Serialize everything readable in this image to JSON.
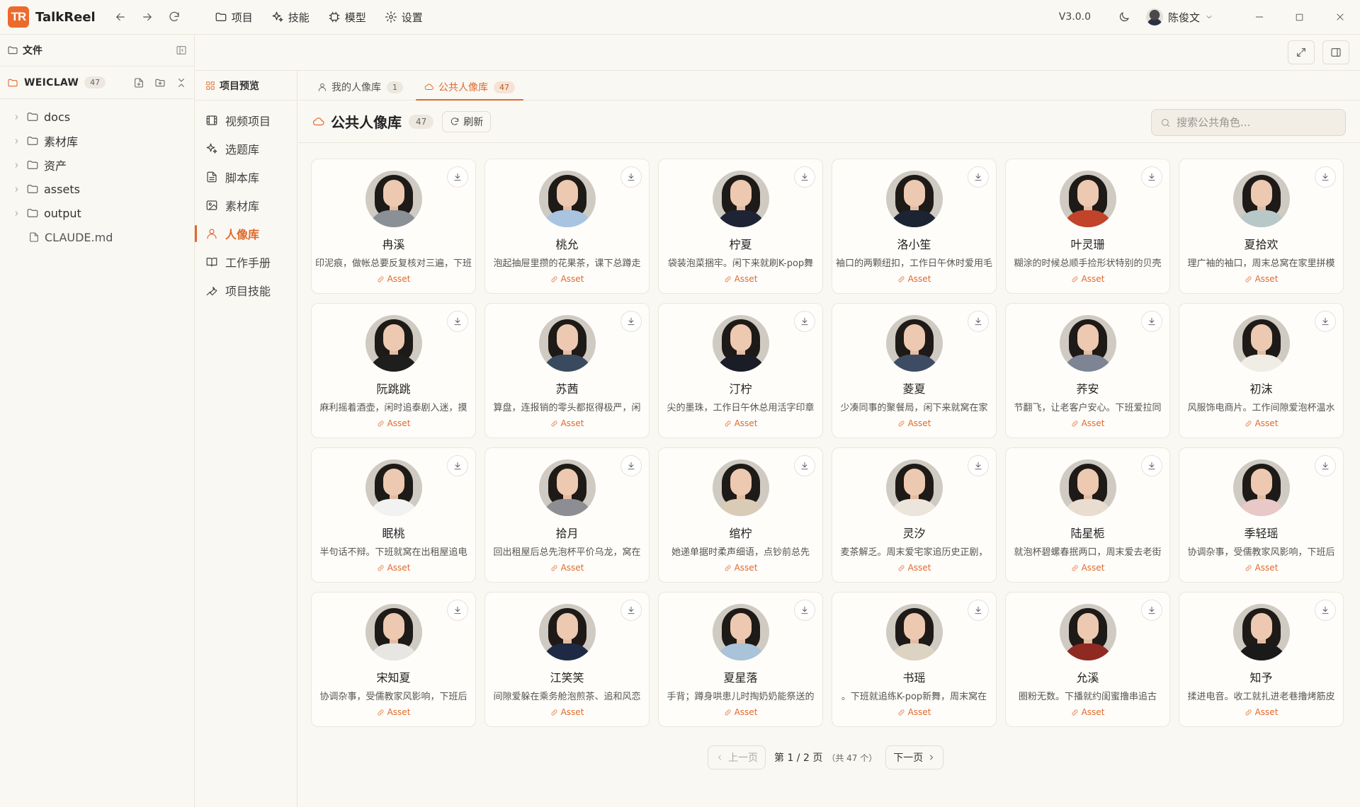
{
  "app": {
    "name": "TalkReel",
    "logo_text": "TR",
    "version": "V3.0.0",
    "user": "陈俊文",
    "accent": "#e0692c"
  },
  "menu": [
    "项目",
    "技能",
    "模型",
    "设置"
  ],
  "file_panel": {
    "title": "文件",
    "workspace": "WEICLAW",
    "workspace_count": "47",
    "tree": [
      {
        "name": "docs",
        "type": "folder"
      },
      {
        "name": "素材库",
        "type": "folder"
      },
      {
        "name": "资产",
        "type": "folder"
      },
      {
        "name": "assets",
        "type": "folder"
      },
      {
        "name": "output",
        "type": "folder"
      },
      {
        "name": "CLAUDE.md",
        "type": "file"
      }
    ]
  },
  "project_nav": {
    "title": "项目预览",
    "items": [
      {
        "label": "视频项目",
        "icon": "film-icon",
        "active": false
      },
      {
        "label": "选题库",
        "icon": "sparkle-icon",
        "active": false
      },
      {
        "label": "脚本库",
        "icon": "document-icon",
        "active": false
      },
      {
        "label": "素材库",
        "icon": "image-icon",
        "active": false
      },
      {
        "label": "人像库",
        "icon": "user-icon",
        "active": true
      },
      {
        "label": "工作手册",
        "icon": "book-icon",
        "active": false
      },
      {
        "label": "项目技能",
        "icon": "wrench-icon",
        "active": false
      }
    ]
  },
  "tabs": [
    {
      "label": "我的人像库",
      "count": "1",
      "active": false
    },
    {
      "label": "公共人像库",
      "count": "47",
      "active": true
    }
  ],
  "library": {
    "title": "公共人像库",
    "count": "47",
    "refresh_label": "刷新",
    "search_placeholder": "搜索公共角色..."
  },
  "asset_label": "Asset",
  "cards": [
    {
      "name": "冉溪",
      "desc": "印泥痕，做帐总要反复核对三遍，下班",
      "top": "#8b8f96"
    },
    {
      "name": "桃允",
      "desc": "泡起抽屉里攒的花果茶，课下总蹲走",
      "top": "#a8c4e0"
    },
    {
      "name": "柠夏",
      "desc": "袋装泡菜捆牢。闲下来就刷K-pop舞",
      "top": "#1f2336"
    },
    {
      "name": "洛小笙",
      "desc": "袖口的两颗纽扣，工作日午休时爱用毛",
      "top": "#1c2333"
    },
    {
      "name": "叶灵珊",
      "desc": "糊涂的时候总顺手捡形状特别的贝壳",
      "top": "#c0432a"
    },
    {
      "name": "夏拾欢",
      "desc": "理广袖的袖口，周末总窝在家里拼模",
      "top": "#b8c8c8"
    },
    {
      "name": "阮跳跳",
      "desc": "麻利摇着酒壶，闲时追泰剧入迷，摸",
      "top": "#1e1e1e"
    },
    {
      "name": "苏茜",
      "desc": "算盘，连报销的零头都抠得极严，闲",
      "top": "#3a4a5e"
    },
    {
      "name": "汀柠",
      "desc": "尖的墨珠，工作日午休总用活字印章",
      "top": "#1a1d26"
    },
    {
      "name": "菱夏",
      "desc": "少凑同事的聚餐局，闲下来就窝在家",
      "top": "#3e4c63"
    },
    {
      "name": "荞安",
      "desc": "节翻飞，让老客户安心。下班爱拉同",
      "top": "#7d8594"
    },
    {
      "name": "初沫",
      "desc": "风服饰电商片。工作间隙爱泡杯温水",
      "top": "#f0ede6"
    },
    {
      "name": "眠桃",
      "desc": "半句话不辩。下班就窝在出租屋追电",
      "top": "#f2f2f2"
    },
    {
      "name": "拾月",
      "desc": "回出租屋后总先泡杯平价乌龙，窝在",
      "top": "#8c8e94"
    },
    {
      "name": "绾柠",
      "desc": "她递单据时柔声细语，点钞前总先",
      "top": "#d9cbb5"
    },
    {
      "name": "灵汐",
      "desc": "麦茶解乏。周末爱宅家追历史正剧，",
      "top": "#ece5dc"
    },
    {
      "name": "陆星栀",
      "desc": "就泡杯碧螺春抿两口，周末爱去老街",
      "top": "#e8ddd0"
    },
    {
      "name": "季轻瑶",
      "desc": "协调杂事，受儒教家风影响，下班后",
      "top": "#e9c8c8"
    },
    {
      "name": "宋知夏",
      "desc": "协调杂事，受儒教家风影响，下班后",
      "top": "#e8e6e2"
    },
    {
      "name": "江笑笑",
      "desc": "间隙爱躲在乘务舱泡煎茶、追和风恋",
      "top": "#1e2a44"
    },
    {
      "name": "夏星落",
      "desc": "手背；蹲身哄患儿时掏奶奶能祭送的",
      "top": "#a9c3d9"
    },
    {
      "name": "书瑶",
      "desc": "。下班就追练K-pop新舞，周末窝在",
      "top": "#ddd3c2"
    },
    {
      "name": "允溪",
      "desc": "圈粉无数。下播就约闺蜜撸串追古",
      "top": "#8e2a22"
    },
    {
      "name": "知予",
      "desc": "揉进电音。收工就扎进老巷撸烤筋皮",
      "top": "#1a1a1a"
    }
  ],
  "pagination": {
    "prev": "上一页",
    "next": "下一页",
    "info": "第 1 / 2 页",
    "total": "（共 47 个）"
  }
}
